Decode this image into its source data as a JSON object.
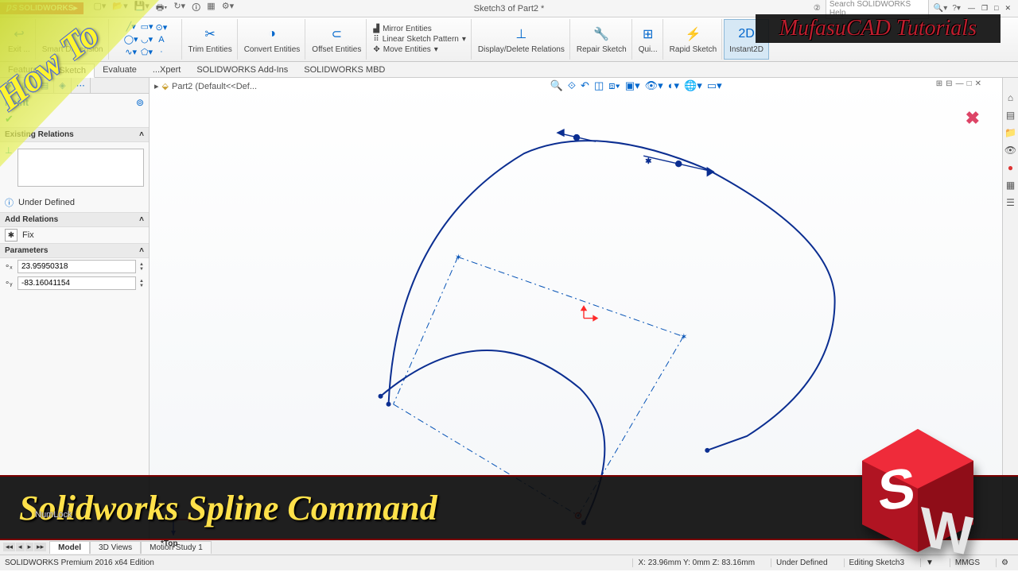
{
  "app": {
    "brand": "SOLIDWORKS",
    "doc_title": "Sketch3 of Part2 *"
  },
  "search": {
    "placeholder": "Search SOLIDWORKS Help"
  },
  "ribbon": {
    "exit": "Exit ...",
    "smart_dim": "Smart Dimension",
    "trim": "Trim Entities",
    "convert": "Convert Entities",
    "offset": "Offset Entities",
    "mirror": "Mirror Entities",
    "linear_pattern": "Linear Sketch Pattern",
    "move": "Move Entities",
    "display_rel": "Display/Delete Relations",
    "repair": "Repair Sketch",
    "quick": "Qui...",
    "rapid": "Rapid Sketch",
    "instant": "Instant2D"
  },
  "tabs": {
    "features": "Features",
    "sketch": "Sketch",
    "evaluate": "Evaluate",
    "xpert": "...Xpert",
    "addins": "SOLIDWORKS Add-Ins",
    "mbd": "SOLIDWORKS MBD"
  },
  "tree": {
    "root": "Part2  (Default<<Def..."
  },
  "pm": {
    "title": "Point",
    "existing_relations": "Existing Relations",
    "under_defined": "Under Defined",
    "add_relations": "Add Relations",
    "fix": "Fix",
    "parameters": "Parameters",
    "param_x": "23.95950318",
    "param_y": "-83.16041154"
  },
  "view_tabs": {
    "model": "Model",
    "views3d": "3D Views",
    "motion": "Motion Study 1"
  },
  "status": {
    "edition": "SOLIDWORKS Premium 2016 x64 Edition",
    "coords": "X: 23.96mm Y: 0mm Z: 83.16mm",
    "state": "Under Defined",
    "mode": "Editing Sketch3",
    "units": "MMGS"
  },
  "overlay": {
    "howto": "How To",
    "channel": "MufasuCAD Tutorials",
    "title": "Solidworks Spline Command",
    "numlock": "NumLock",
    "top": "*Top"
  }
}
